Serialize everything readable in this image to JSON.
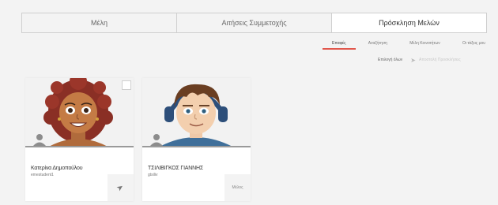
{
  "tabs": [
    {
      "label": "Μέλη",
      "active": false
    },
    {
      "label": "Αιτήσεις Συμμετοχής",
      "active": false
    },
    {
      "label": "Πρόσκληση Μελών",
      "active": true
    }
  ],
  "subtabs": [
    {
      "label": "Επαφές",
      "active": true
    },
    {
      "label": "Αναζήτηση",
      "active": false
    },
    {
      "label": "Μέλη Κοινοτήτων",
      "active": false
    },
    {
      "label": "Οι τάξεις μου",
      "active": false
    }
  ],
  "actions": {
    "select_all": "Επιλογή όλων",
    "send_invites": "Αποστολή Προσκλήσεις",
    "send_icon": "send-icon"
  },
  "cards": [
    {
      "name": "Κατερίνα Δημοπούλου",
      "username": "emestudent1",
      "button_icon": "send-icon",
      "accent": "#e1574c"
    },
    {
      "name": "ΤΣΙΛΙΒΙΓΚΟΣ ΓΙΑΝΝΗΣ",
      "username": "gtsiliv",
      "button_label": "Μέλος"
    }
  ],
  "colors": {
    "accent": "#e1574c",
    "background": "#f3f3f3"
  }
}
